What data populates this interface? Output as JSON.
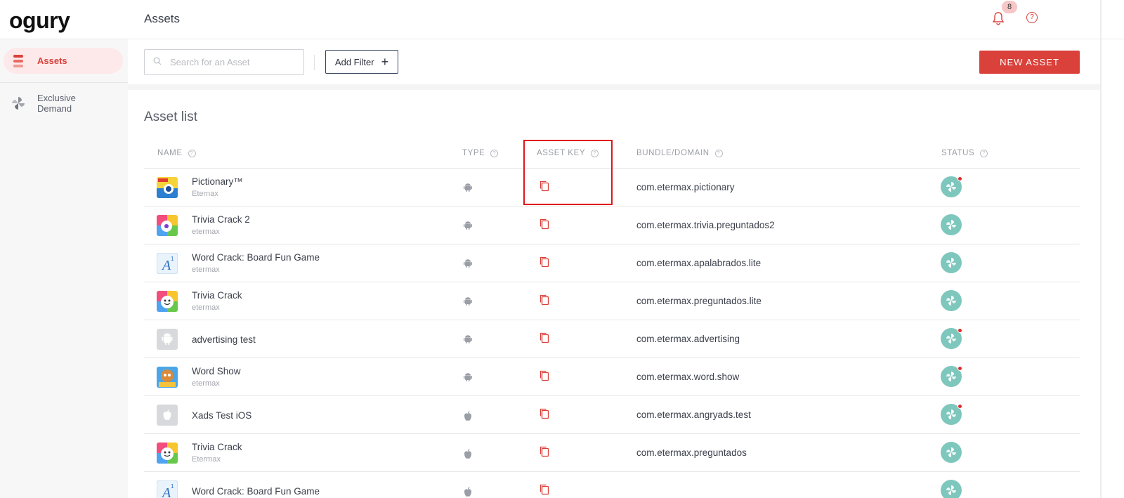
{
  "app": {
    "logo": "ogury",
    "page_title": "Assets"
  },
  "sidebar": {
    "items": [
      {
        "label": "Assets",
        "icon": "assets-stack-icon",
        "active": true
      },
      {
        "label": "Exclusive\nDemand",
        "icon": "pinwheel-icon",
        "active": false
      }
    ]
  },
  "header": {
    "notification_count": "8",
    "help_label": "?"
  },
  "toolbar": {
    "search_placeholder": "Search for an Asset",
    "add_filter_label": "Add Filter",
    "add_filter_icon": "+",
    "new_asset_label": "NEW ASSET"
  },
  "colors": {
    "accent": "#d9413a",
    "status": "#7ec7bd",
    "highlight": "#e0141b"
  },
  "asset_list": {
    "title": "Asset list",
    "columns": [
      "NAME",
      "TYPE",
      "ASSET KEY",
      "BUNDLE/DOMAIN",
      "STATUS"
    ],
    "rows": [
      {
        "name": "Pictionary™",
        "publisher": "Eternax",
        "type": "android",
        "bundle": "com.etermax.pictionary",
        "alert": true,
        "icon": "pictionary"
      },
      {
        "name": "Trivia Crack 2",
        "publisher": "etermax",
        "type": "android",
        "bundle": "com.etermax.trivia.preguntados2",
        "alert": false,
        "icon": "trivia2"
      },
      {
        "name": "Word Crack: Board Fun Game",
        "publisher": "etermax",
        "type": "android",
        "bundle": "com.etermax.apalabrados.lite",
        "alert": false,
        "icon": "wordcrack"
      },
      {
        "name": "Trivia Crack",
        "publisher": "etermax",
        "type": "android",
        "bundle": "com.etermax.preguntados.lite",
        "alert": false,
        "icon": "trivia"
      },
      {
        "name": "advertising test",
        "publisher": "",
        "type": "android",
        "bundle": "com.etermax.advertising",
        "alert": true,
        "icon": "placeholder-android"
      },
      {
        "name": "Word Show",
        "publisher": "etermax",
        "type": "android",
        "bundle": "com.etermax.word.show",
        "alert": true,
        "icon": "wordshow"
      },
      {
        "name": "Xads Test iOS",
        "publisher": "",
        "type": "apple",
        "bundle": "com.etermax.angryads.test",
        "alert": true,
        "icon": "placeholder-apple"
      },
      {
        "name": "Trivia Crack",
        "publisher": "Etermax",
        "type": "apple",
        "bundle": "com.etermax.preguntados",
        "alert": false,
        "icon": "trivia"
      },
      {
        "name": "Word Crack: Board Fun Game",
        "publisher": "",
        "type": "apple",
        "bundle": "",
        "alert": false,
        "icon": "wordcrack"
      }
    ]
  }
}
